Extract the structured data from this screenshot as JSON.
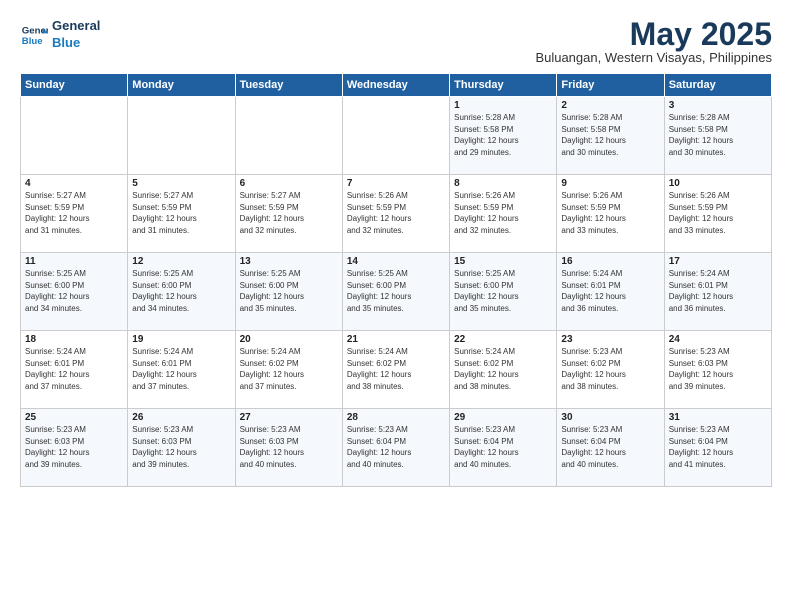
{
  "logo": {
    "line1": "General",
    "line2": "Blue"
  },
  "title": "May 2025",
  "subtitle": "Buluangan, Western Visayas, Philippines",
  "days_of_week": [
    "Sunday",
    "Monday",
    "Tuesday",
    "Wednesday",
    "Thursday",
    "Friday",
    "Saturday"
  ],
  "weeks": [
    [
      {
        "day": "",
        "content": ""
      },
      {
        "day": "",
        "content": ""
      },
      {
        "day": "",
        "content": ""
      },
      {
        "day": "",
        "content": ""
      },
      {
        "day": "1",
        "content": "Sunrise: 5:28 AM\nSunset: 5:58 PM\nDaylight: 12 hours\nand 29 minutes."
      },
      {
        "day": "2",
        "content": "Sunrise: 5:28 AM\nSunset: 5:58 PM\nDaylight: 12 hours\nand 30 minutes."
      },
      {
        "day": "3",
        "content": "Sunrise: 5:28 AM\nSunset: 5:58 PM\nDaylight: 12 hours\nand 30 minutes."
      }
    ],
    [
      {
        "day": "4",
        "content": "Sunrise: 5:27 AM\nSunset: 5:59 PM\nDaylight: 12 hours\nand 31 minutes."
      },
      {
        "day": "5",
        "content": "Sunrise: 5:27 AM\nSunset: 5:59 PM\nDaylight: 12 hours\nand 31 minutes."
      },
      {
        "day": "6",
        "content": "Sunrise: 5:27 AM\nSunset: 5:59 PM\nDaylight: 12 hours\nand 32 minutes."
      },
      {
        "day": "7",
        "content": "Sunrise: 5:26 AM\nSunset: 5:59 PM\nDaylight: 12 hours\nand 32 minutes."
      },
      {
        "day": "8",
        "content": "Sunrise: 5:26 AM\nSunset: 5:59 PM\nDaylight: 12 hours\nand 32 minutes."
      },
      {
        "day": "9",
        "content": "Sunrise: 5:26 AM\nSunset: 5:59 PM\nDaylight: 12 hours\nand 33 minutes."
      },
      {
        "day": "10",
        "content": "Sunrise: 5:26 AM\nSunset: 5:59 PM\nDaylight: 12 hours\nand 33 minutes."
      }
    ],
    [
      {
        "day": "11",
        "content": "Sunrise: 5:25 AM\nSunset: 6:00 PM\nDaylight: 12 hours\nand 34 minutes."
      },
      {
        "day": "12",
        "content": "Sunrise: 5:25 AM\nSunset: 6:00 PM\nDaylight: 12 hours\nand 34 minutes."
      },
      {
        "day": "13",
        "content": "Sunrise: 5:25 AM\nSunset: 6:00 PM\nDaylight: 12 hours\nand 35 minutes."
      },
      {
        "day": "14",
        "content": "Sunrise: 5:25 AM\nSunset: 6:00 PM\nDaylight: 12 hours\nand 35 minutes."
      },
      {
        "day": "15",
        "content": "Sunrise: 5:25 AM\nSunset: 6:00 PM\nDaylight: 12 hours\nand 35 minutes."
      },
      {
        "day": "16",
        "content": "Sunrise: 5:24 AM\nSunset: 6:01 PM\nDaylight: 12 hours\nand 36 minutes."
      },
      {
        "day": "17",
        "content": "Sunrise: 5:24 AM\nSunset: 6:01 PM\nDaylight: 12 hours\nand 36 minutes."
      }
    ],
    [
      {
        "day": "18",
        "content": "Sunrise: 5:24 AM\nSunset: 6:01 PM\nDaylight: 12 hours\nand 37 minutes."
      },
      {
        "day": "19",
        "content": "Sunrise: 5:24 AM\nSunset: 6:01 PM\nDaylight: 12 hours\nand 37 minutes."
      },
      {
        "day": "20",
        "content": "Sunrise: 5:24 AM\nSunset: 6:02 PM\nDaylight: 12 hours\nand 37 minutes."
      },
      {
        "day": "21",
        "content": "Sunrise: 5:24 AM\nSunset: 6:02 PM\nDaylight: 12 hours\nand 38 minutes."
      },
      {
        "day": "22",
        "content": "Sunrise: 5:24 AM\nSunset: 6:02 PM\nDaylight: 12 hours\nand 38 minutes."
      },
      {
        "day": "23",
        "content": "Sunrise: 5:23 AM\nSunset: 6:02 PM\nDaylight: 12 hours\nand 38 minutes."
      },
      {
        "day": "24",
        "content": "Sunrise: 5:23 AM\nSunset: 6:03 PM\nDaylight: 12 hours\nand 39 minutes."
      }
    ],
    [
      {
        "day": "25",
        "content": "Sunrise: 5:23 AM\nSunset: 6:03 PM\nDaylight: 12 hours\nand 39 minutes."
      },
      {
        "day": "26",
        "content": "Sunrise: 5:23 AM\nSunset: 6:03 PM\nDaylight: 12 hours\nand 39 minutes."
      },
      {
        "day": "27",
        "content": "Sunrise: 5:23 AM\nSunset: 6:03 PM\nDaylight: 12 hours\nand 40 minutes."
      },
      {
        "day": "28",
        "content": "Sunrise: 5:23 AM\nSunset: 6:04 PM\nDaylight: 12 hours\nand 40 minutes."
      },
      {
        "day": "29",
        "content": "Sunrise: 5:23 AM\nSunset: 6:04 PM\nDaylight: 12 hours\nand 40 minutes."
      },
      {
        "day": "30",
        "content": "Sunrise: 5:23 AM\nSunset: 6:04 PM\nDaylight: 12 hours\nand 40 minutes."
      },
      {
        "day": "31",
        "content": "Sunrise: 5:23 AM\nSunset: 6:04 PM\nDaylight: 12 hours\nand 41 minutes."
      }
    ]
  ]
}
